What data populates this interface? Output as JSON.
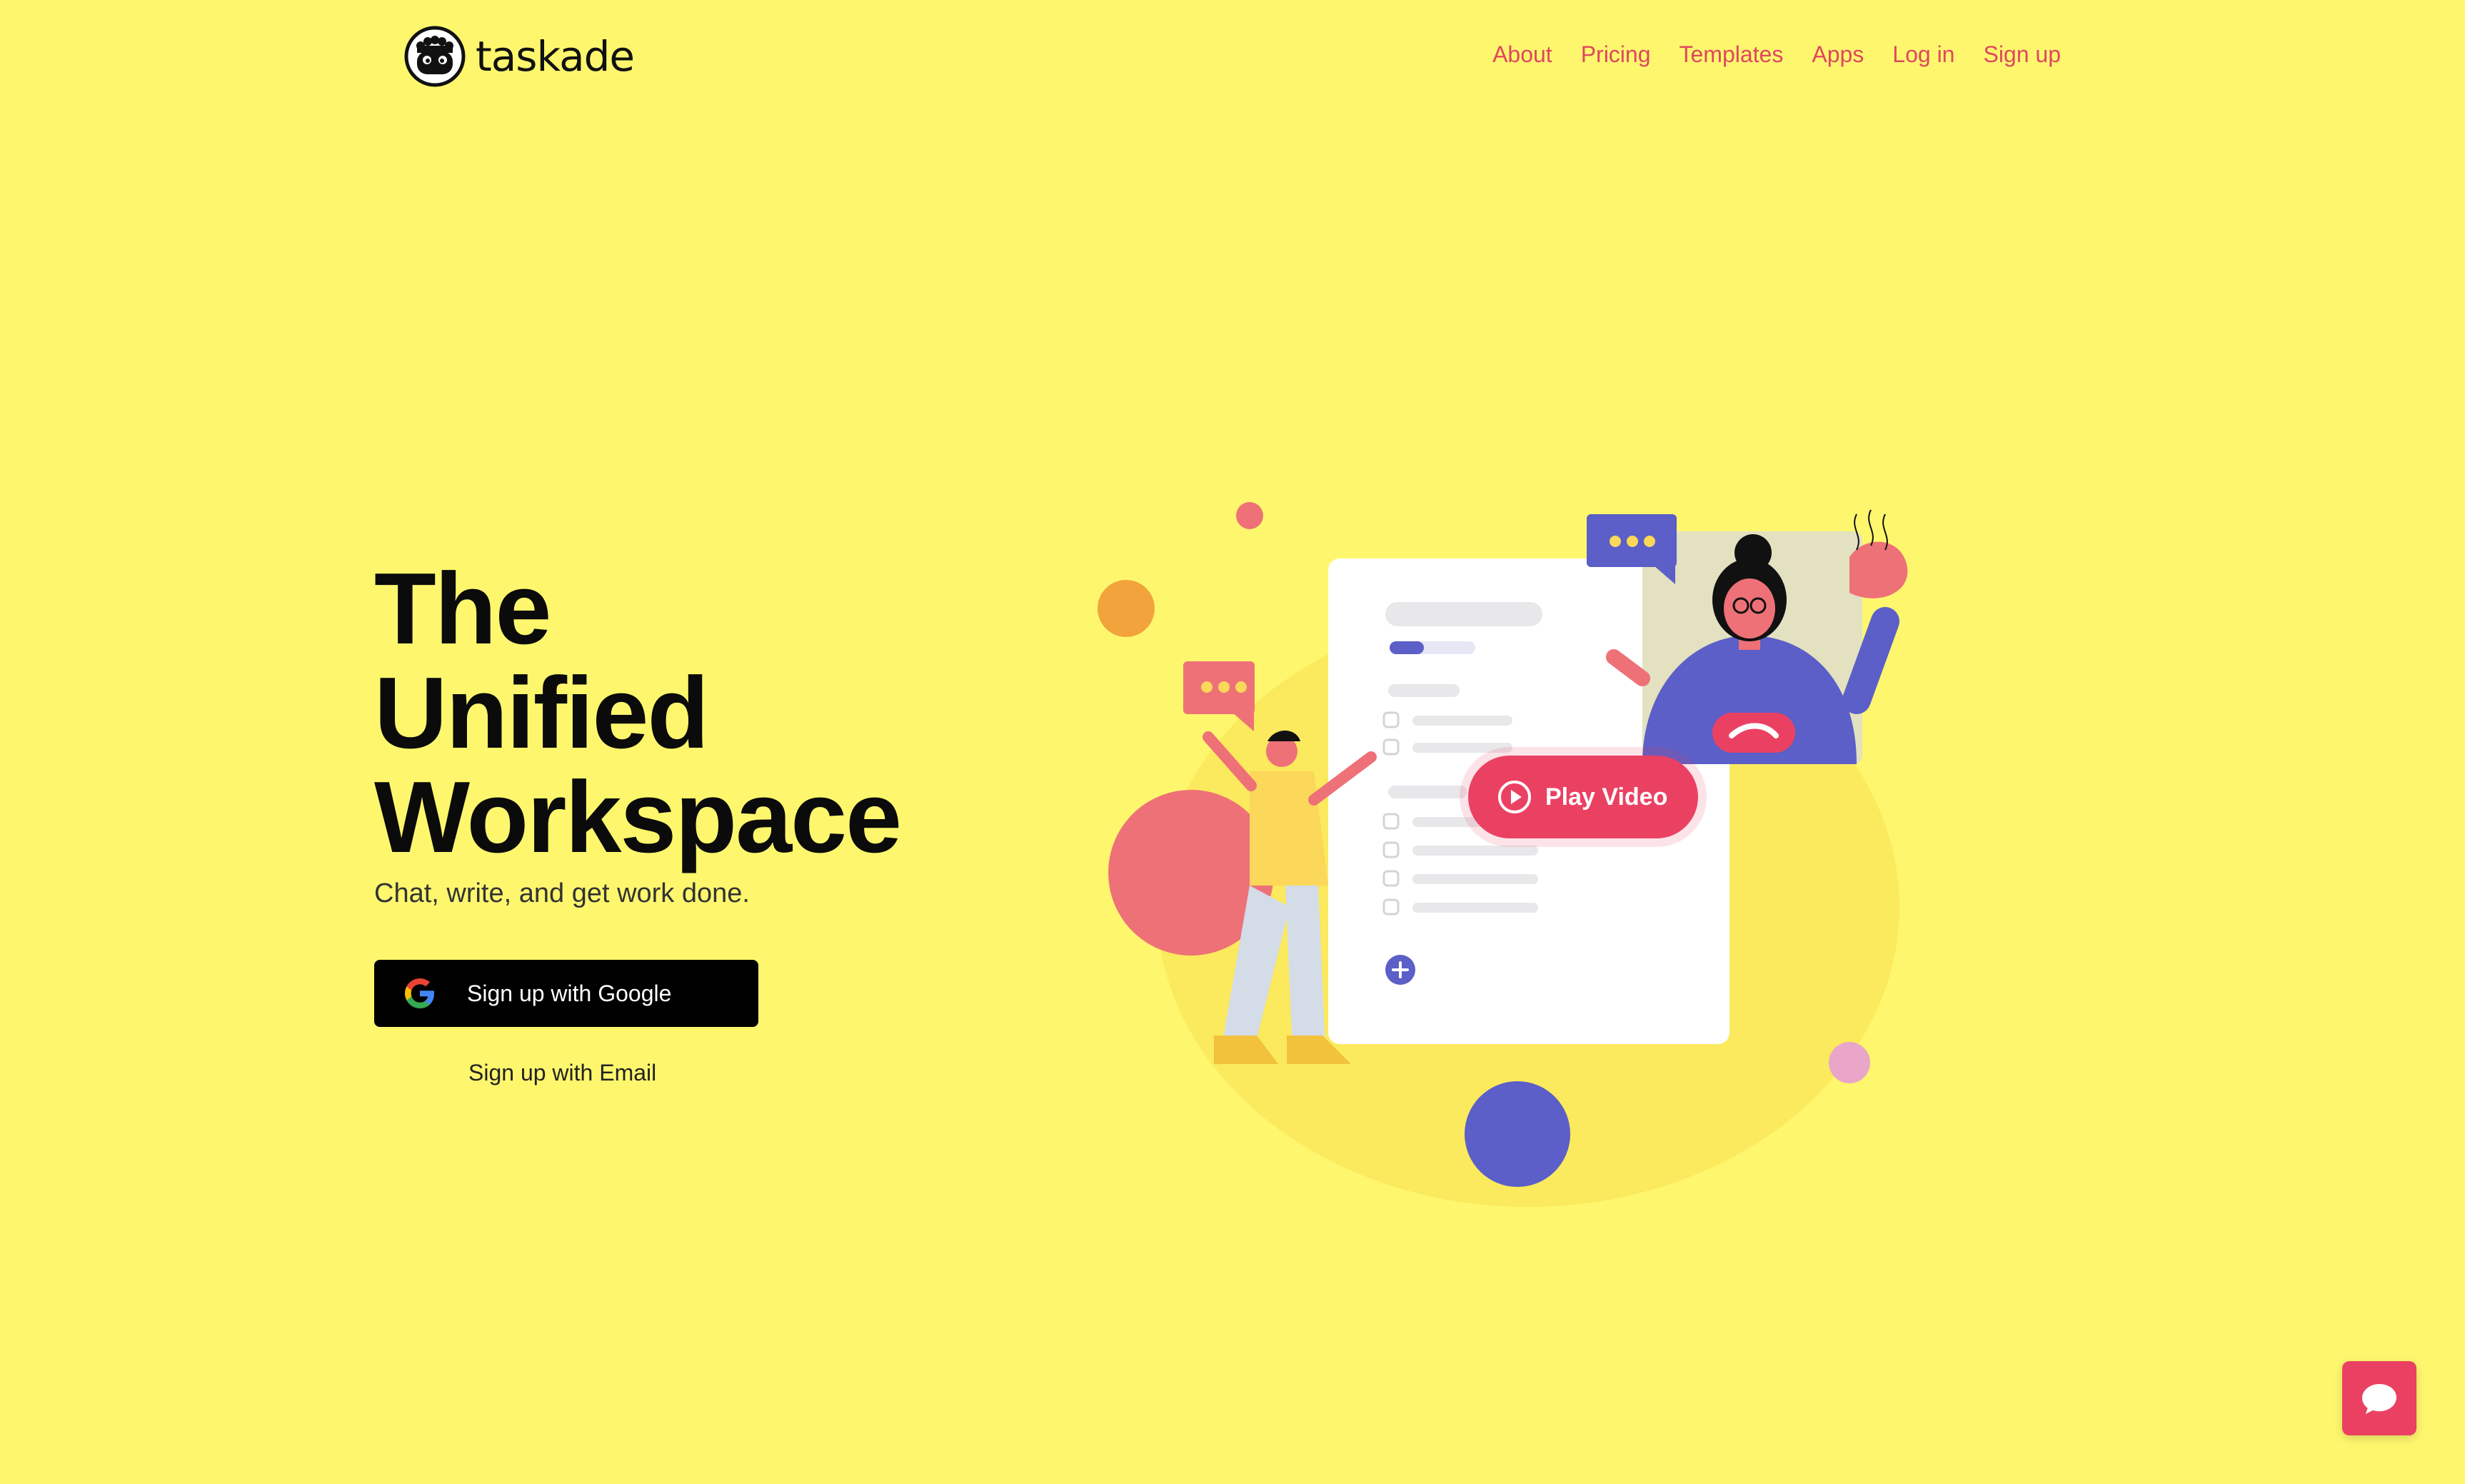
{
  "brand": {
    "name": "taskade",
    "logo_icon": "sheep-logo-icon"
  },
  "nav": {
    "items": [
      {
        "label": "About"
      },
      {
        "label": "Pricing"
      },
      {
        "label": "Templates"
      },
      {
        "label": "Apps"
      },
      {
        "label": "Log in"
      },
      {
        "label": "Sign up"
      }
    ]
  },
  "hero": {
    "title_lines": [
      "The",
      "Unified",
      "Workspace"
    ],
    "subtitle": "Chat, write, and get work done.",
    "google_button": {
      "label": "Sign up with Google",
      "icon": "google-icon"
    },
    "email_link": "Sign up with Email"
  },
  "video": {
    "label": "Play Video",
    "icon": "play-icon"
  },
  "chat_widget": {
    "icon": "chat-bubble-icon"
  },
  "colors": {
    "background": "#fef76e",
    "accent": "#ea4163",
    "nav_text": "#e0475f",
    "indigo": "#5b5fc7",
    "orange": "#f2a33c",
    "coral": "#ee7177",
    "pink": "#e9a6c8"
  }
}
